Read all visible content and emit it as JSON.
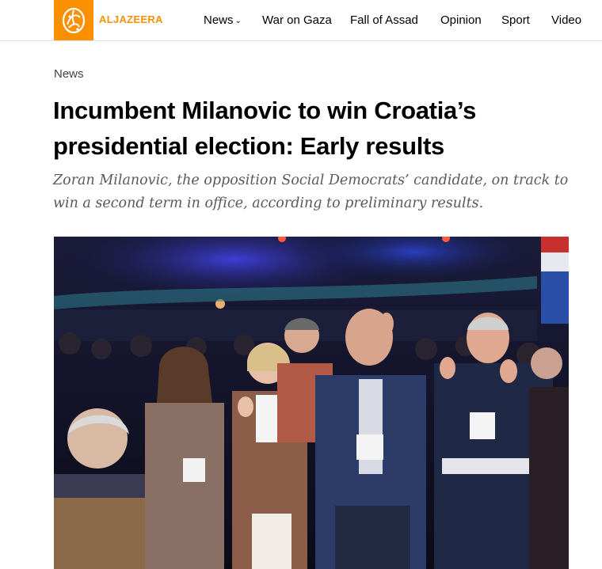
{
  "header": {
    "logo_text": "ALJAZEERA",
    "logo_icon": "aljazeera-calligraphy-icon",
    "nav": [
      {
        "label": "News",
        "has_dropdown": true
      },
      {
        "label": "War on Gaza"
      },
      {
        "label": "Fall of Assad"
      },
      {
        "label": "Opinion"
      },
      {
        "label": "Sport"
      },
      {
        "label": "Video"
      }
    ]
  },
  "article": {
    "category": "News",
    "title": "Incumbent Milanovic to win Croatia’s presidential election: Early results",
    "standfirst": "Zoran Milanovic, the opposition Social Democrats’ candidate, on track to win a second term in office, according to preliminary results.",
    "image_description": "photo"
  },
  "colors": {
    "brand": "#fa9000",
    "text": "#000000",
    "standfirst": "#5a5a5a"
  }
}
